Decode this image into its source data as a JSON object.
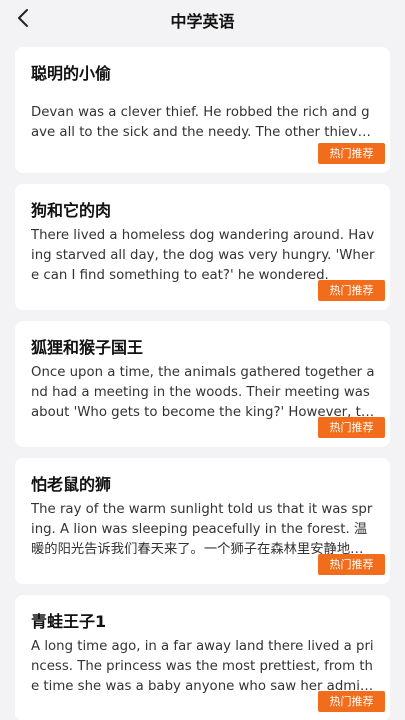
{
  "header": {
    "title": "中学英语"
  },
  "articles": [
    {
      "title": "聪明的小偷",
      "body": "Devan was a clever thief. He robbed the rich and gave all to the sick and the needy. The other thieves wanted to be like him.",
      "tag": "热门推荐"
    },
    {
      "title": "狗和它的肉",
      "body": "There lived a homeless dog wandering around. Having starved all day, the dog was very hungry. 'Where can I find something to eat?' he wondered.",
      "tag": "热门推荐"
    },
    {
      "title": "狐狸和猴子国王",
      "body": "Once upon a time, the animals gathered together and had a meeting in the woods. Their meeting was about 'Who gets to become the king?' However, they could not agree.",
      "tag": "热门推荐"
    },
    {
      "title": "怕老鼠的狮",
      "body": "The ray of the warm sunlight told us that it was spring. A lion was sleeping peacefully in the forest. 温暖的阳光告诉我们春天来了。一个狮子在森林里安静地睡觉。",
      "tag": "热门推荐"
    },
    {
      "title": "青蛙王子1",
      "body": "A long time ago, in a far away land there lived a princess. The princess was the most prettiest, from the time she was a baby anyone who saw her admired her.",
      "tag": "热门推荐"
    }
  ]
}
